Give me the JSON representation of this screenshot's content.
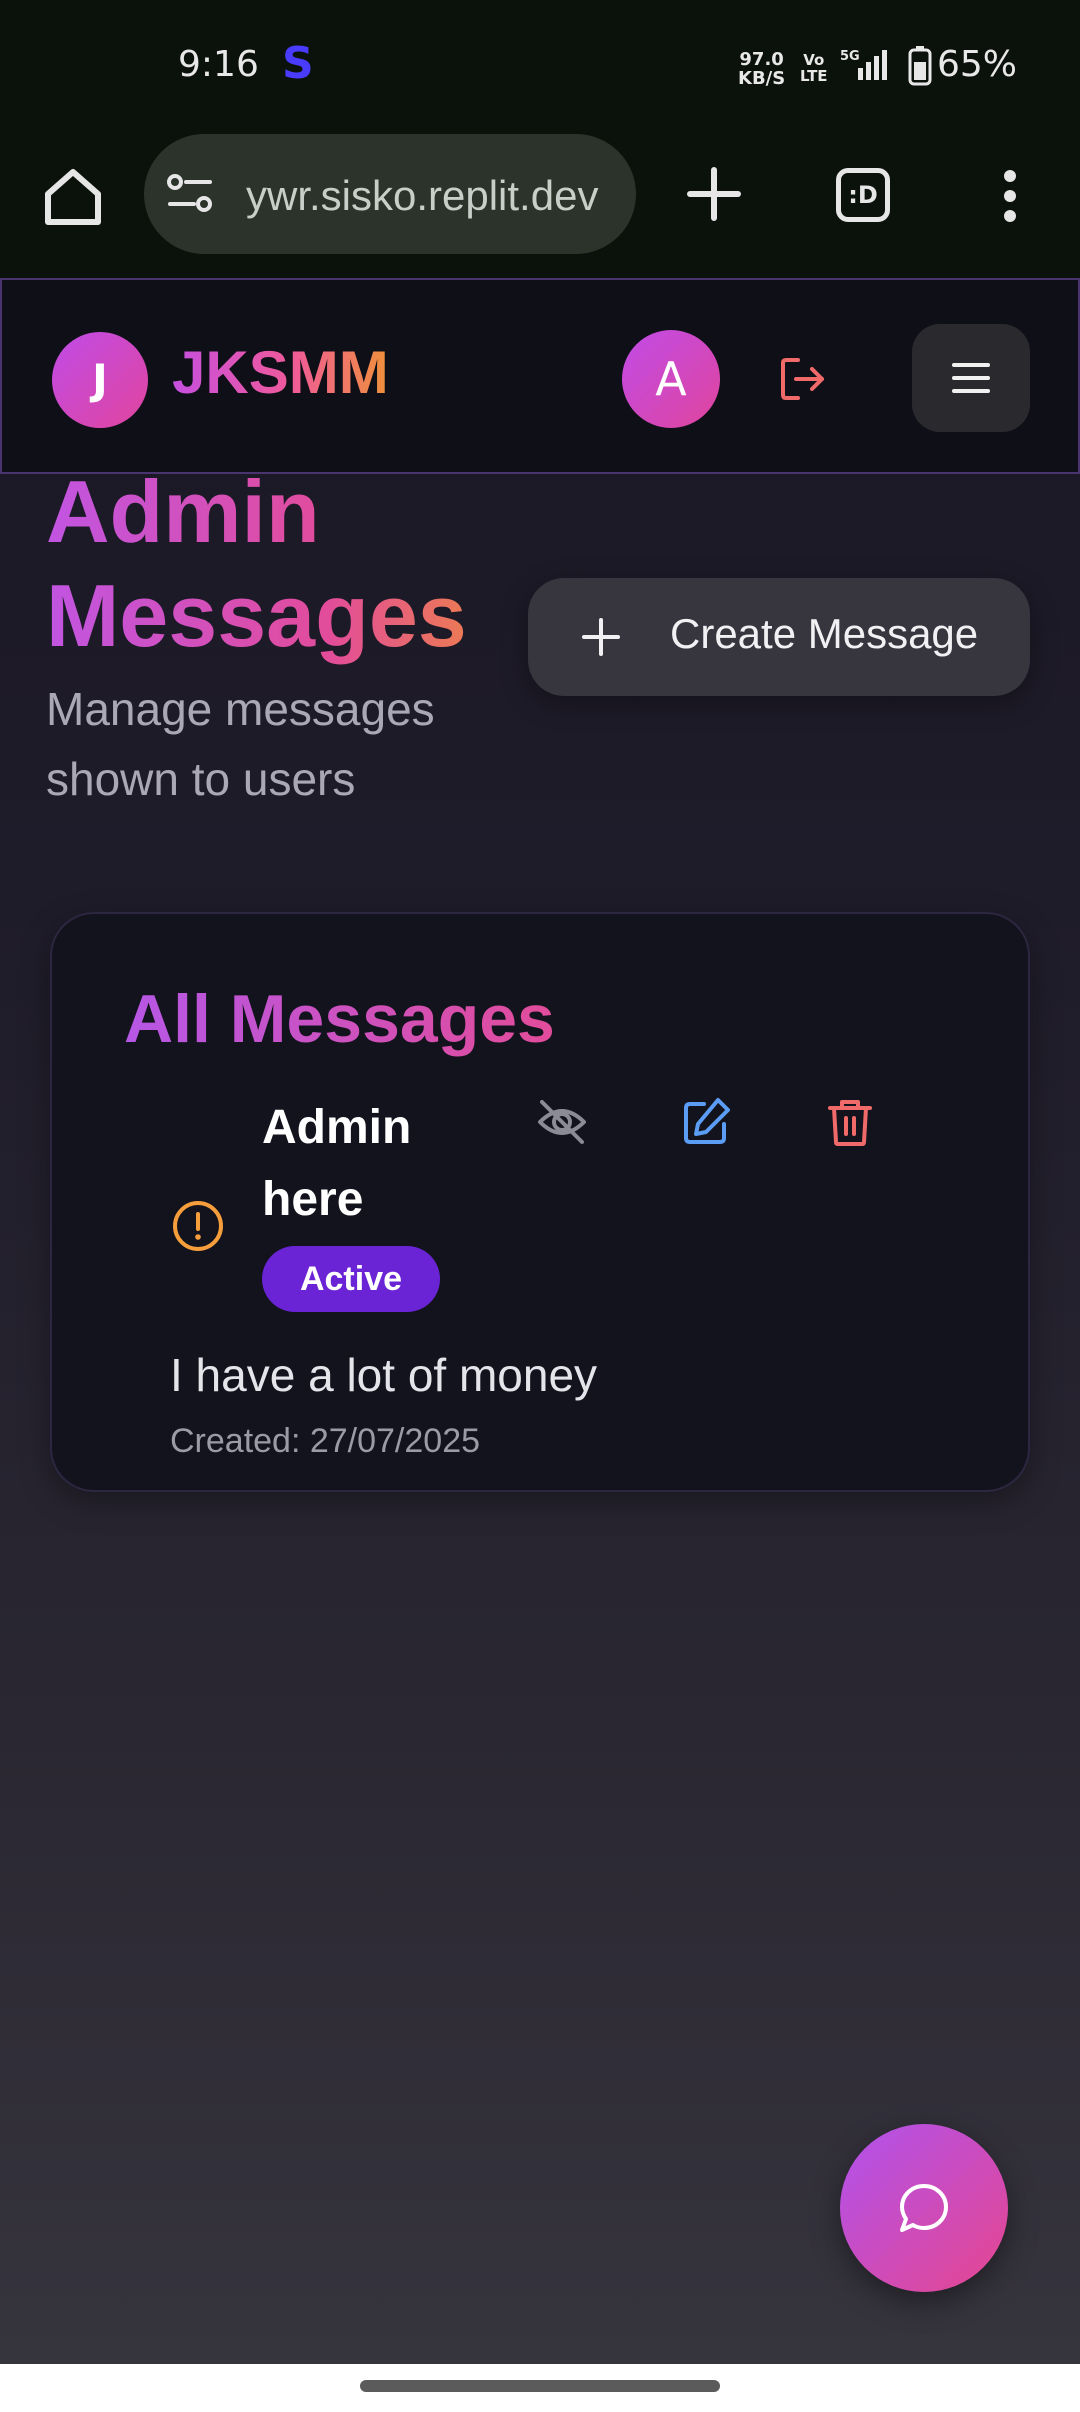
{
  "status_bar": {
    "time": "9:16",
    "app_letter": "S",
    "net_speed": "97.0",
    "net_unit": "KB/S",
    "volte_1": "Vo",
    "volte_2": "LTE",
    "network": "5G",
    "battery": "65%"
  },
  "browser": {
    "url": "ywr.sisko.replit.dev",
    "tabs_label": ":D",
    "icons": [
      "home-icon",
      "site-settings-icon",
      "new-tab-icon",
      "tab-switcher-icon",
      "more-vert-icon"
    ]
  },
  "header": {
    "logo_letter": "J",
    "brand": "JKSMM",
    "avatar_letter": "A",
    "icons": [
      "logout-icon",
      "hamburger-menu-icon"
    ]
  },
  "page": {
    "title_line1": "Admin",
    "title_line2": "Messages",
    "subtitle": "Manage messages shown to users",
    "create_button": "Create Message"
  },
  "card": {
    "title": "All Messages",
    "message": {
      "title": "Admin here",
      "status": "Active",
      "body": "I have a lot of money",
      "created": "Created: 27/07/2025",
      "icons": [
        "alert-circle-icon",
        "eye-off-icon",
        "edit-icon",
        "trash-icon"
      ]
    }
  },
  "colors": {
    "accent_purple": "#c04ce8",
    "accent_pink": "#e0449c",
    "accent_orange": "#f0913a",
    "badge_active": "#6a24d6",
    "alert_orange": "#f59e3b",
    "edit_blue": "#5b9cf5",
    "delete_red": "#f06a6a"
  },
  "fab": {
    "icon": "chat-bubble-icon"
  }
}
